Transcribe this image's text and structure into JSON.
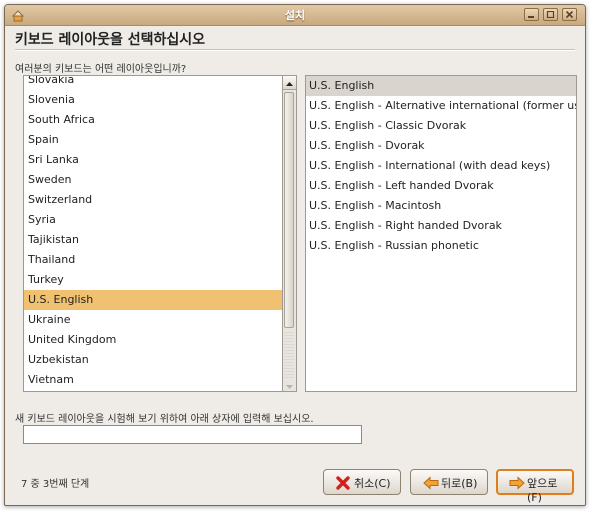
{
  "window": {
    "title": "설치"
  },
  "page": {
    "heading": "키보드 레이아웃을 선택하십시오",
    "question": "여러분의 키보드는 어떤 레이아웃입니까?",
    "instruction": "새 키보드 레이아웃을 시험해 보기 위하여 아래 상자에 입력해 보십시오.",
    "step": "7 중 3번째 단계"
  },
  "countries": {
    "items": [
      "Slovakia",
      "Slovenia",
      "South Africa",
      "Spain",
      "Sri Lanka",
      "Sweden",
      "Switzerland",
      "Syria",
      "Tajikistan",
      "Thailand",
      "Turkey",
      "U.S. English",
      "Ukraine",
      "United Kingdom",
      "Uzbekistan",
      "Vietnam"
    ],
    "selected": "U.S. English"
  },
  "variants": {
    "items": [
      "U.S. English",
      "U.S. English - Alternative international (former us_intl)",
      "U.S. English - Classic Dvorak",
      "U.S. English - Dvorak",
      "U.S. English - International (with dead keys)",
      "U.S. English - Left handed Dvorak",
      "U.S. English - Macintosh",
      "U.S. English - Right handed Dvorak",
      "U.S. English - Russian phonetic"
    ],
    "selected": "U.S. English"
  },
  "test_input": {
    "value": ""
  },
  "buttons": {
    "cancel": "취소(C)",
    "back": "뒤로(B)",
    "forward": "앞으로(F)"
  },
  "icons": {
    "cancel": "red-x-icon",
    "back": "left-arrow-icon",
    "forward": "right-arrow-icon"
  },
  "colors": {
    "selection": "#f0c170",
    "accent": "#e07d1c",
    "titlebar": "#c9a97f"
  }
}
